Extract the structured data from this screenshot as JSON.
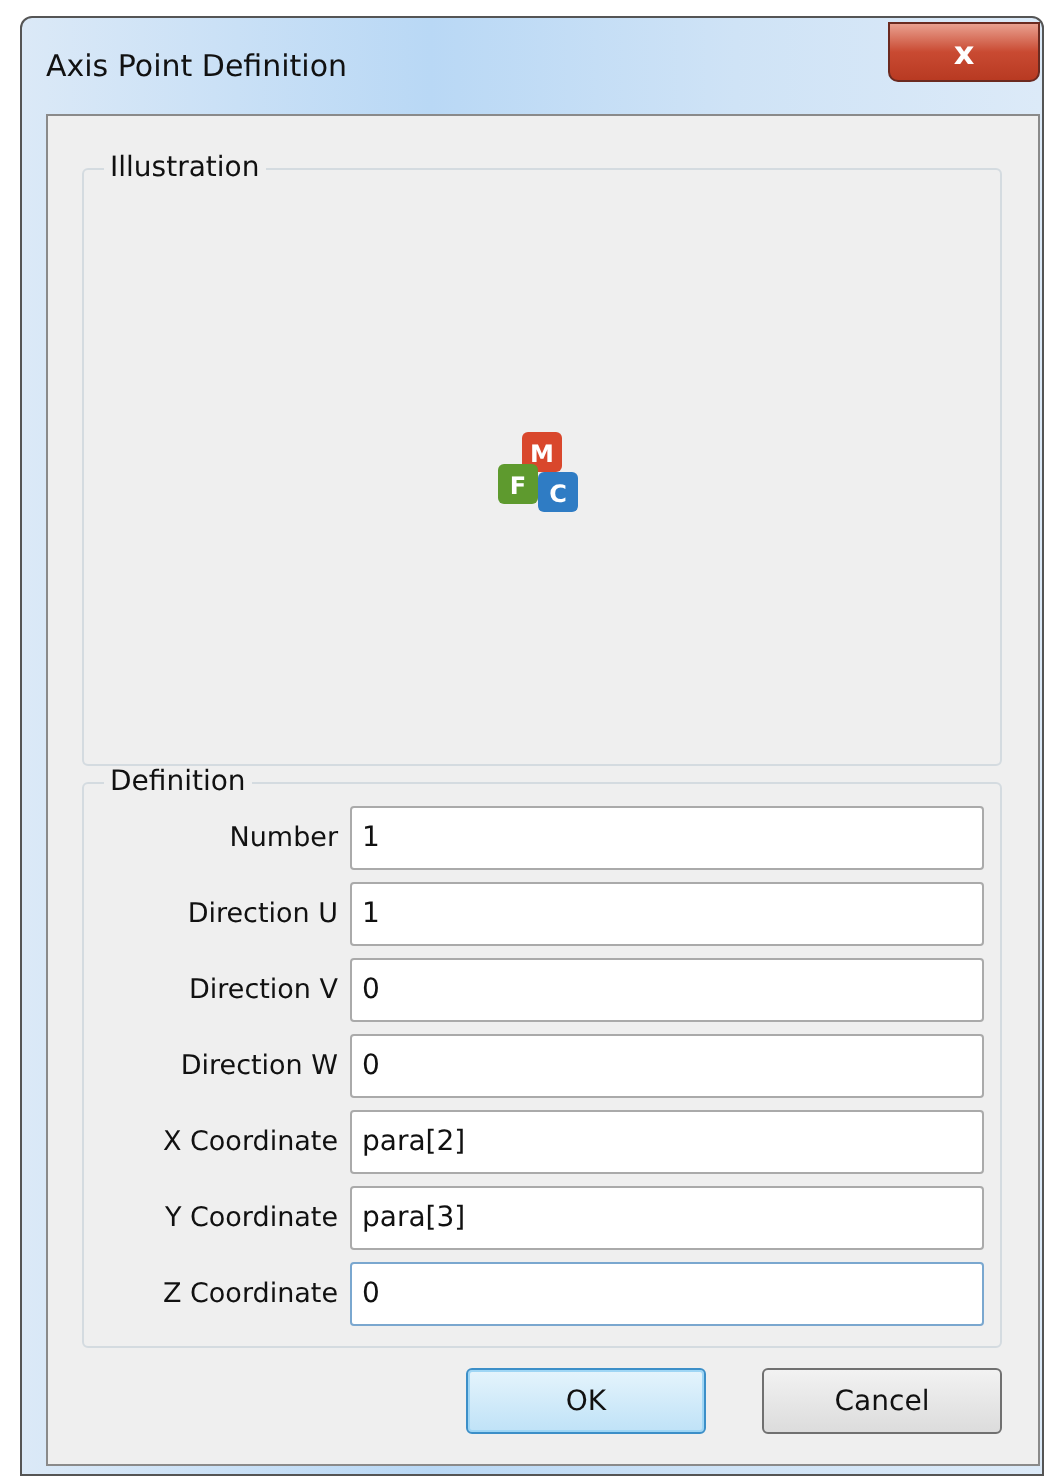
{
  "window": {
    "title": "Axis Point Definition",
    "close": "x"
  },
  "illustration": {
    "title": "Illustration",
    "logo_letters": [
      "M",
      "F",
      "C"
    ]
  },
  "definition": {
    "title": "Definition",
    "fields": [
      {
        "label": "Number",
        "value": "1",
        "focused": false
      },
      {
        "label": "Direction U",
        "value": "1",
        "focused": false
      },
      {
        "label": "Direction V",
        "value": "0",
        "focused": false
      },
      {
        "label": "Direction W",
        "value": "0",
        "focused": false
      },
      {
        "label": "X Coordinate",
        "value": "para[2]",
        "focused": false
      },
      {
        "label": "Y Coordinate",
        "value": "para[3]",
        "focused": false
      },
      {
        "label": "Z Coordinate",
        "value": "0",
        "focused": true
      }
    ]
  },
  "buttons": [
    {
      "label": "OK",
      "default": true
    },
    {
      "label": "Cancel",
      "default": false
    }
  ]
}
